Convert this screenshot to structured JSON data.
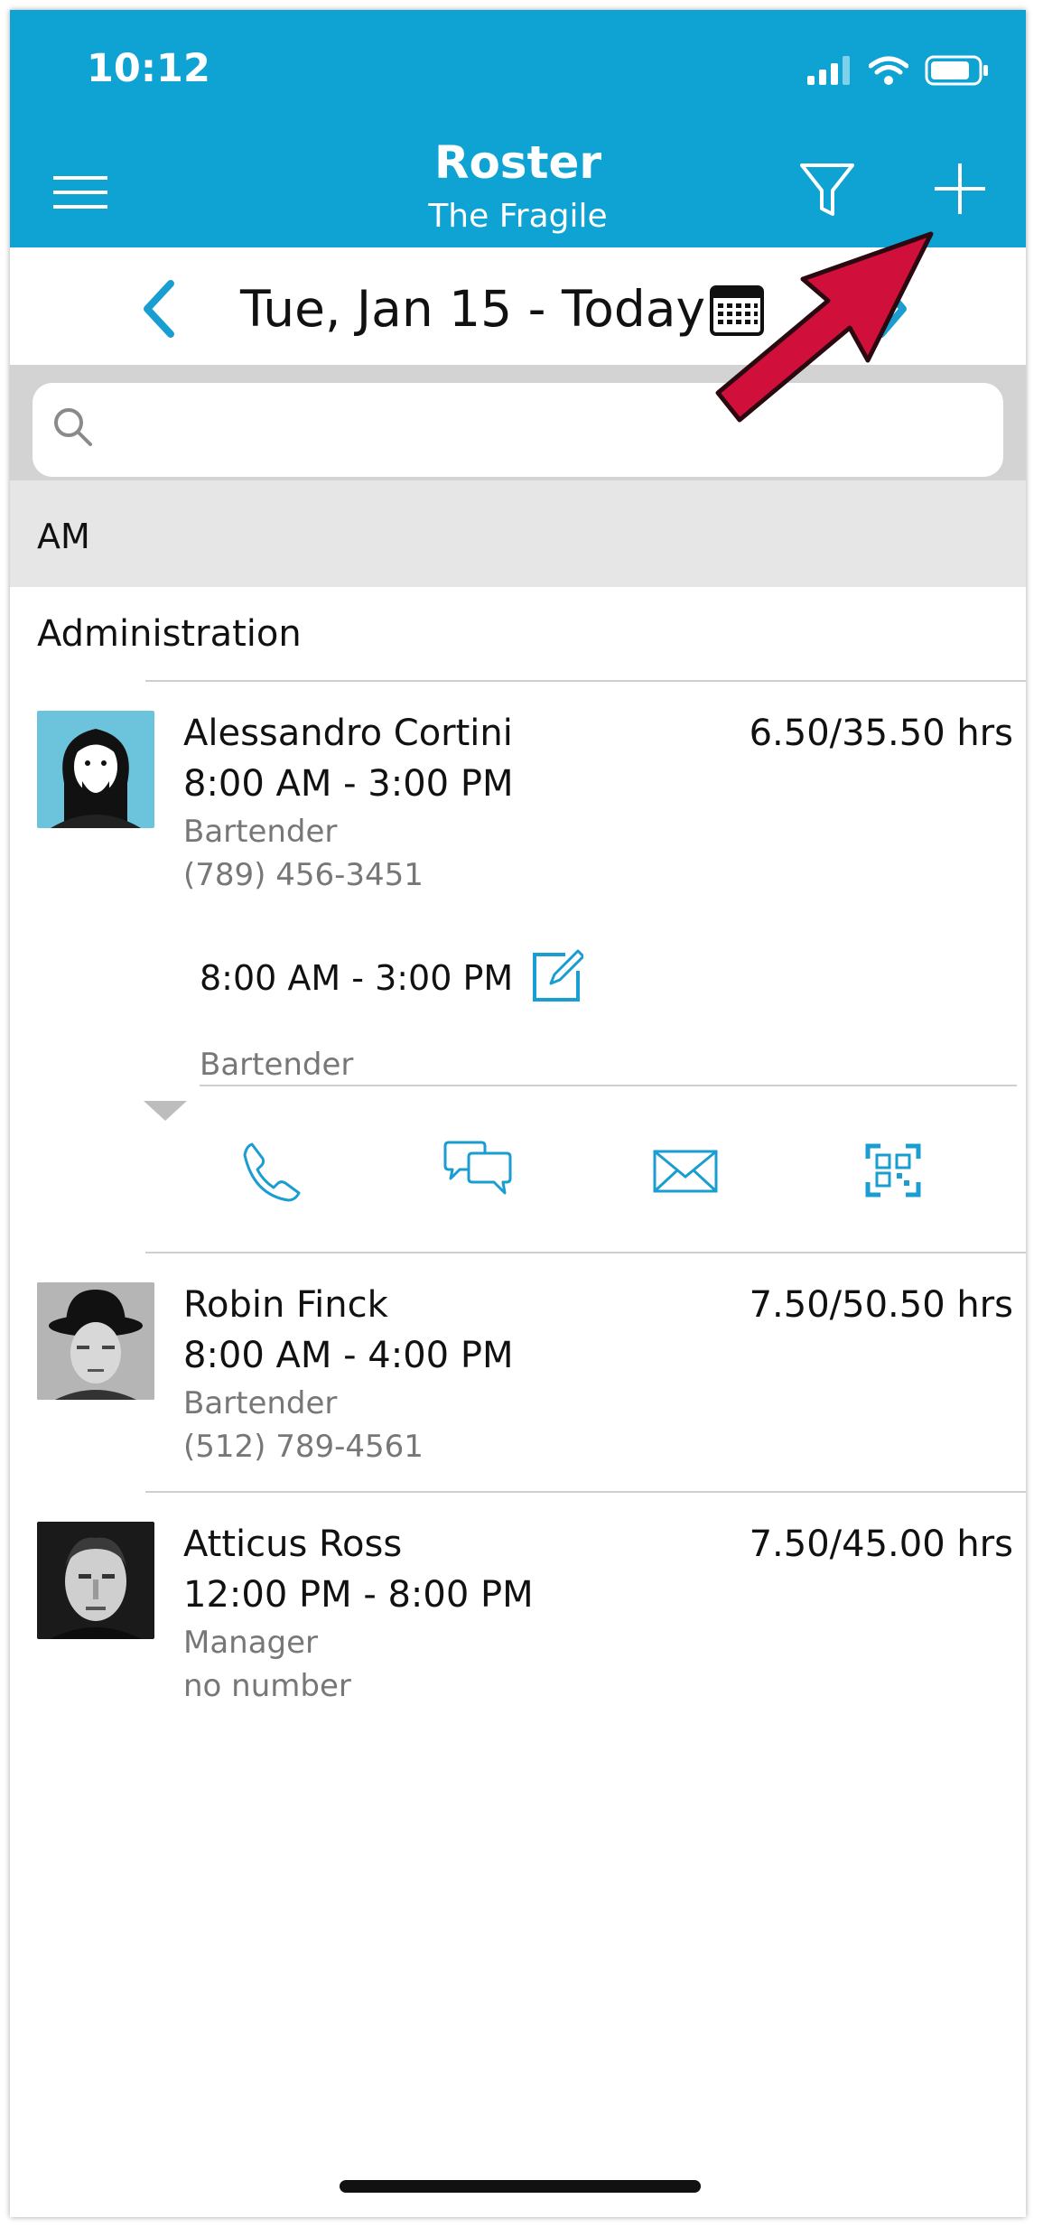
{
  "status_bar": {
    "time": "10:12"
  },
  "header": {
    "title": "Roster",
    "subtitle": "The Fragile"
  },
  "date_nav": {
    "date_label": "Tue, Jan 15 - Today"
  },
  "search": {
    "placeholder": ""
  },
  "section": {
    "label": "AM"
  },
  "group": {
    "label": "Administration"
  },
  "employees": [
    {
      "name": "Alessandro Cortini",
      "hours": "6.50/35.50 hrs",
      "time": "8:00 AM - 3:00 PM",
      "role": "Bartender",
      "phone": "(789) 456-3451"
    },
    {
      "name": "Robin Finck",
      "hours": "7.50/50.50 hrs",
      "time": "8:00 AM - 4:00 PM",
      "role": "Bartender",
      "phone": "(512) 789-4561"
    },
    {
      "name": "Atticus Ross",
      "hours": "7.50/45.00 hrs",
      "time": "12:00 PM - 8:00 PM",
      "role": "Manager",
      "phone": "no number"
    }
  ],
  "expanded_shift": {
    "time": "8:00 AM - 3:00 PM",
    "role": "Bartender"
  },
  "icons": [
    "menu-icon",
    "filter-icon",
    "plus-icon",
    "chevron-left-icon",
    "calendar-icon",
    "chevron-right-icon",
    "search-icon",
    "edit-icon",
    "phone-icon",
    "chat-icon",
    "mail-icon",
    "qr-icon",
    "annotation-arrow"
  ],
  "colors": {
    "header": "#0ea3d2",
    "accent": "#1a9ed2",
    "arrow": "#d0103a"
  }
}
